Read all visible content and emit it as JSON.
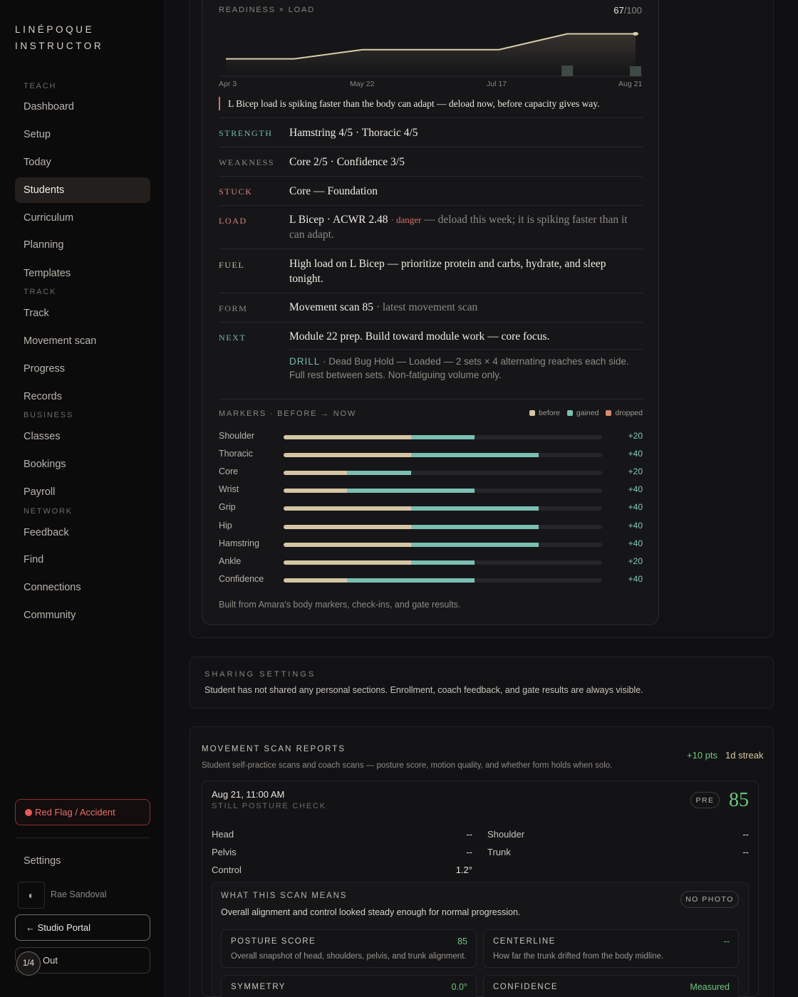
{
  "brand": {
    "line1": "LINÉPOQUE",
    "line2": "INSTRUCTOR"
  },
  "nav": {
    "sections": [
      {
        "label": "TEACH",
        "items": [
          "Dashboard",
          "Setup",
          "Today",
          "Students",
          "Curriculum",
          "Planning",
          "Templates"
        ]
      },
      {
        "label": "TRACK",
        "items": [
          "Track",
          "Movement scan",
          "Progress",
          "Records"
        ]
      },
      {
        "label": "BUSINESS",
        "items": [
          "Classes",
          "Bookings",
          "Payroll"
        ]
      },
      {
        "label": "NETWORK",
        "items": [
          "Feedback",
          "Find",
          "Connections",
          "Community"
        ]
      }
    ],
    "active": "Students",
    "red_flag": "Red Flag / Accident",
    "settings": "Settings",
    "theme_icon": "◐",
    "user": "Rae Sandoval",
    "studio_portal": "← Studio Portal",
    "out": "Out",
    "pager": "1/4"
  },
  "readiness": {
    "label": "READINESS × LOAD",
    "score": "67",
    "score_max": "/100",
    "x_ticks": [
      "Apr 3",
      "May 22",
      "Jul 17",
      "Aug 21"
    ],
    "alert": "L Bicep load is spiking faster than the body can adapt — deload now, before capacity gives way."
  },
  "chart_data": {
    "type": "line",
    "title": "READINESS × LOAD",
    "x": [
      "Apr 3",
      "",
      "May 22",
      "",
      "Jul 17",
      "",
      "Aug 21"
    ],
    "readiness": [
      22,
      22,
      36,
      36,
      36,
      60,
      60
    ],
    "load_bars": [
      0,
      0,
      0,
      0,
      0,
      15,
      14
    ],
    "ylim": [
      0,
      100
    ],
    "colors": {
      "line": "#d8cbaa",
      "fill": "#3a3630",
      "bars": "#3f4a47"
    }
  },
  "insights": [
    {
      "label": "STRENGTH",
      "tone": "teal",
      "value": "Hamstring 4/5 · Thoracic 4/5"
    },
    {
      "label": "WEAKNESS",
      "tone": "grey",
      "value": "Core 2/5 · Confidence 3/5"
    },
    {
      "label": "STUCK",
      "tone": "red",
      "value": "Core — Foundation"
    },
    {
      "label": "LOAD",
      "tone": "red",
      "value": "L Bicep · ACWR 2.48",
      "badge": "· danger",
      "rest": " — deload this week; it is spiking faster than it can adapt."
    },
    {
      "label": "FUEL",
      "tone": "sand",
      "value": "High load on L Bicep — prioritize protein and carbs, hydrate, and sleep tonight."
    },
    {
      "label": "FORM",
      "tone": "grey",
      "value": "Movement scan 85",
      "rest": " · latest movement scan"
    },
    {
      "label": "NEXT",
      "tone": "teal",
      "value": "Module 22 prep. Build toward module work — core focus."
    }
  ],
  "drill": {
    "tag": "DRILL",
    "text": " · Dead Bug Hold — Loaded — 2 sets × 4 alternating reaches each side. Full rest between sets. Non-fatiguing volume only."
  },
  "markers": {
    "title": "MARKERS · BEFORE → NOW",
    "legend": [
      {
        "label": "before",
        "color": "#d4c6a4"
      },
      {
        "label": "gained",
        "color": "#7bbfb3"
      },
      {
        "label": "dropped",
        "color": "#d98a70"
      }
    ],
    "rows": [
      {
        "name": "Shoulder",
        "before": 2,
        "now": 3,
        "delta": "+20"
      },
      {
        "name": "Thoracic",
        "before": 2,
        "now": 4,
        "delta": "+40"
      },
      {
        "name": "Core",
        "before": 1,
        "now": 2,
        "delta": "+20"
      },
      {
        "name": "Wrist",
        "before": 1,
        "now": 3,
        "delta": "+40"
      },
      {
        "name": "Grip",
        "before": 2,
        "now": 4,
        "delta": "+40"
      },
      {
        "name": "Hip",
        "before": 2,
        "now": 4,
        "delta": "+40"
      },
      {
        "name": "Hamstring",
        "before": 2,
        "now": 4,
        "delta": "+40"
      },
      {
        "name": "Ankle",
        "before": 2,
        "now": 3,
        "delta": "+20"
      },
      {
        "name": "Confidence",
        "before": 1,
        "now": 3,
        "delta": "+40"
      }
    ],
    "scale_max": 5,
    "footer": "Built from Amara's body markers, check-ins, and gate results."
  },
  "sharing": {
    "title": "SHARING SETTINGS",
    "desc": "Student has not shared any personal sections. Enrollment, coach feedback, and gate results are always visible."
  },
  "scans": {
    "title": "MOVEMENT SCAN REPORTS",
    "desc": "Student self-practice scans and coach scans — posture score, motion quality, and whether form holds when solo.",
    "points": "+10 pts",
    "streak": "1d streak",
    "card": {
      "date": "Aug 21, 11:00 AM",
      "type": "STILL POSTURE CHECK",
      "badge": "PRE",
      "score": "85",
      "metrics": [
        {
          "label": "Head",
          "value": "--"
        },
        {
          "label": "Shoulder",
          "value": "--"
        },
        {
          "label": "Pelvis",
          "value": "--"
        },
        {
          "label": "Trunk",
          "value": "--"
        },
        {
          "label": "Control",
          "value": "1.2°"
        }
      ],
      "meaning": {
        "title": "WHAT THIS SCAN MEANS",
        "badge": "NO PHOTO",
        "desc": "Overall alignment and control looked steady enough for normal progression.",
        "cards": [
          {
            "title": "POSTURE SCORE",
            "value": "85",
            "desc": "Overall snapshot of head, shoulders, pelvis, and trunk alignment."
          },
          {
            "title": "CENTERLINE",
            "value": "--",
            "desc": "How far the trunk drifted from the body midline."
          },
          {
            "title": "SYMMETRY",
            "value": "0.0°",
            "desc": ""
          },
          {
            "title": "CONFIDENCE",
            "value": "Measured",
            "desc": ""
          }
        ]
      }
    }
  }
}
